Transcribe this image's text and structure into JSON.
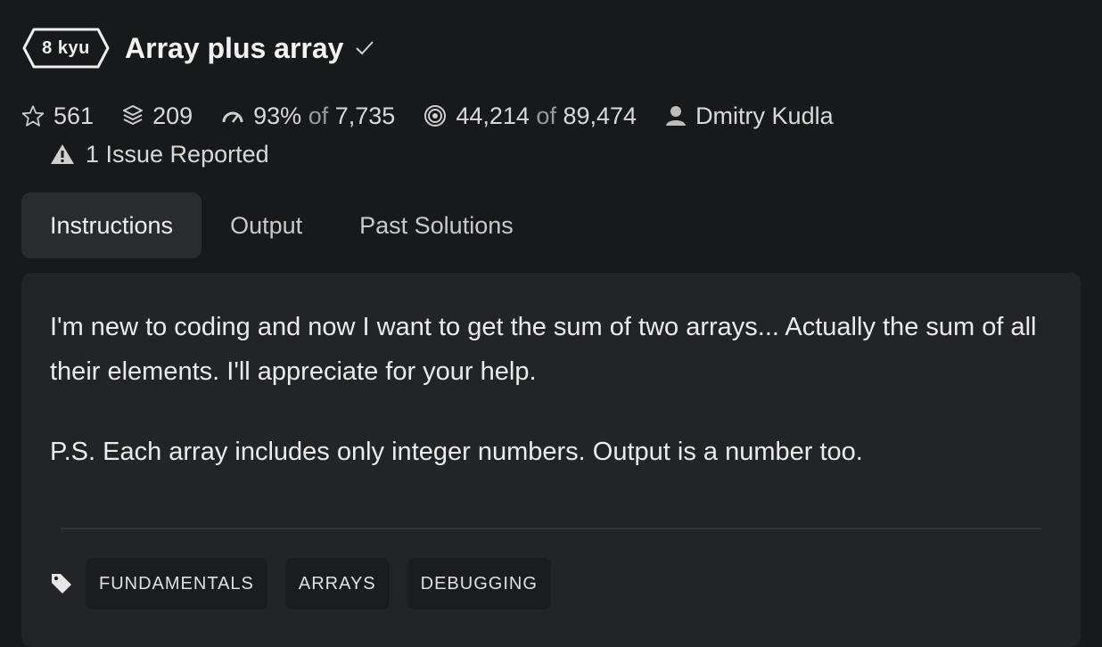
{
  "kata": {
    "rank": "8 kyu",
    "title": "Array plus array",
    "completed_icon": "check-icon"
  },
  "stats": {
    "stars": "561",
    "collections": "209",
    "satisfaction_percent": "93%",
    "satisfaction_of": "of",
    "satisfaction_votes": "7,735",
    "completed": "44,214",
    "completed_of": "of",
    "attempted": "89,474",
    "author": "Dmitry Kudla"
  },
  "issues": {
    "label": "1 Issue Reported"
  },
  "tabs": [
    {
      "label": "Instructions",
      "active": true
    },
    {
      "label": "Output",
      "active": false
    },
    {
      "label": "Past Solutions",
      "active": false
    }
  ],
  "description": {
    "paragraph1": "I'm new to coding and now I want to get the sum of two arrays... Actually the sum of all their elements. I'll appreciate for your help.",
    "paragraph2": "P.S. Each array includes only integer numbers. Output is a number too."
  },
  "tags": [
    "FUNDAMENTALS",
    "ARRAYS",
    "DEBUGGING"
  ],
  "colors": {
    "background": "#18191b",
    "panel": "#232428",
    "active_tab": "#2a2b2f",
    "tag_bg": "#1b1c1f",
    "muted_text": "#9a9a9a"
  }
}
